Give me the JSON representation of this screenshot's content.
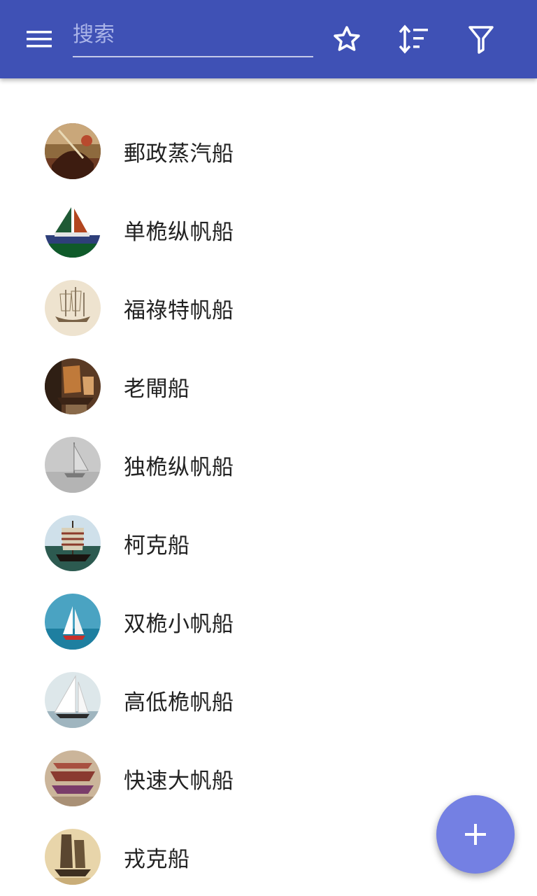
{
  "toolbar": {
    "background": "#3f51b5",
    "search": {
      "placeholder": "搜索",
      "value": ""
    },
    "icons": [
      "menu-icon",
      "star-icon",
      "sort-icon",
      "filter-icon"
    ]
  },
  "list": {
    "items": [
      {
        "label": "郵政蒸汽船",
        "thumb": "painting-ship-thumbnail"
      },
      {
        "label": "单桅纵帆船",
        "thumb": "green-sail-boat-thumbnail"
      },
      {
        "label": "福祿特帆船",
        "thumb": "sketch-ship-thumbnail"
      },
      {
        "label": "老閘船",
        "thumb": "junk-model-thumbnail"
      },
      {
        "label": "独桅纵帆船",
        "thumb": "grey-sketch-ship-thumbnail"
      },
      {
        "label": "柯克船",
        "thumb": "cog-ship-thumbnail"
      },
      {
        "label": "双桅小帆船",
        "thumb": "ketch-sea-thumbnail"
      },
      {
        "label": "高低桅帆船",
        "thumb": "yawl-white-sail-thumbnail"
      },
      {
        "label": "快速大帆船",
        "thumb": "galleon-painting-thumbnail"
      },
      {
        "label": "戎克船",
        "thumb": "junk-sepia-thumbnail"
      }
    ]
  },
  "fab": {
    "icon": "plus-icon",
    "color": "#7480e3"
  }
}
